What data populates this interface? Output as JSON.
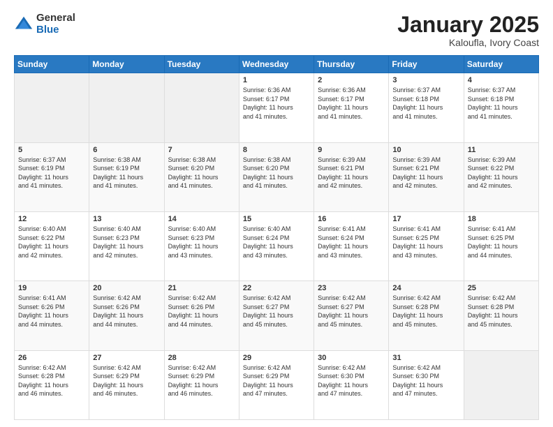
{
  "logo": {
    "general": "General",
    "blue": "Blue"
  },
  "title": {
    "month": "January 2025",
    "location": "Kaloufla, Ivory Coast"
  },
  "weekdays": [
    "Sunday",
    "Monday",
    "Tuesday",
    "Wednesday",
    "Thursday",
    "Friday",
    "Saturday"
  ],
  "weeks": [
    [
      {
        "day": "",
        "info": ""
      },
      {
        "day": "",
        "info": ""
      },
      {
        "day": "",
        "info": ""
      },
      {
        "day": "1",
        "info": "Sunrise: 6:36 AM\nSunset: 6:17 PM\nDaylight: 11 hours\nand 41 minutes."
      },
      {
        "day": "2",
        "info": "Sunrise: 6:36 AM\nSunset: 6:17 PM\nDaylight: 11 hours\nand 41 minutes."
      },
      {
        "day": "3",
        "info": "Sunrise: 6:37 AM\nSunset: 6:18 PM\nDaylight: 11 hours\nand 41 minutes."
      },
      {
        "day": "4",
        "info": "Sunrise: 6:37 AM\nSunset: 6:18 PM\nDaylight: 11 hours\nand 41 minutes."
      }
    ],
    [
      {
        "day": "5",
        "info": "Sunrise: 6:37 AM\nSunset: 6:19 PM\nDaylight: 11 hours\nand 41 minutes."
      },
      {
        "day": "6",
        "info": "Sunrise: 6:38 AM\nSunset: 6:19 PM\nDaylight: 11 hours\nand 41 minutes."
      },
      {
        "day": "7",
        "info": "Sunrise: 6:38 AM\nSunset: 6:20 PM\nDaylight: 11 hours\nand 41 minutes."
      },
      {
        "day": "8",
        "info": "Sunrise: 6:38 AM\nSunset: 6:20 PM\nDaylight: 11 hours\nand 41 minutes."
      },
      {
        "day": "9",
        "info": "Sunrise: 6:39 AM\nSunset: 6:21 PM\nDaylight: 11 hours\nand 42 minutes."
      },
      {
        "day": "10",
        "info": "Sunrise: 6:39 AM\nSunset: 6:21 PM\nDaylight: 11 hours\nand 42 minutes."
      },
      {
        "day": "11",
        "info": "Sunrise: 6:39 AM\nSunset: 6:22 PM\nDaylight: 11 hours\nand 42 minutes."
      }
    ],
    [
      {
        "day": "12",
        "info": "Sunrise: 6:40 AM\nSunset: 6:22 PM\nDaylight: 11 hours\nand 42 minutes."
      },
      {
        "day": "13",
        "info": "Sunrise: 6:40 AM\nSunset: 6:23 PM\nDaylight: 11 hours\nand 42 minutes."
      },
      {
        "day": "14",
        "info": "Sunrise: 6:40 AM\nSunset: 6:23 PM\nDaylight: 11 hours\nand 43 minutes."
      },
      {
        "day": "15",
        "info": "Sunrise: 6:40 AM\nSunset: 6:24 PM\nDaylight: 11 hours\nand 43 minutes."
      },
      {
        "day": "16",
        "info": "Sunrise: 6:41 AM\nSunset: 6:24 PM\nDaylight: 11 hours\nand 43 minutes."
      },
      {
        "day": "17",
        "info": "Sunrise: 6:41 AM\nSunset: 6:25 PM\nDaylight: 11 hours\nand 43 minutes."
      },
      {
        "day": "18",
        "info": "Sunrise: 6:41 AM\nSunset: 6:25 PM\nDaylight: 11 hours\nand 44 minutes."
      }
    ],
    [
      {
        "day": "19",
        "info": "Sunrise: 6:41 AM\nSunset: 6:26 PM\nDaylight: 11 hours\nand 44 minutes."
      },
      {
        "day": "20",
        "info": "Sunrise: 6:42 AM\nSunset: 6:26 PM\nDaylight: 11 hours\nand 44 minutes."
      },
      {
        "day": "21",
        "info": "Sunrise: 6:42 AM\nSunset: 6:26 PM\nDaylight: 11 hours\nand 44 minutes."
      },
      {
        "day": "22",
        "info": "Sunrise: 6:42 AM\nSunset: 6:27 PM\nDaylight: 11 hours\nand 45 minutes."
      },
      {
        "day": "23",
        "info": "Sunrise: 6:42 AM\nSunset: 6:27 PM\nDaylight: 11 hours\nand 45 minutes."
      },
      {
        "day": "24",
        "info": "Sunrise: 6:42 AM\nSunset: 6:28 PM\nDaylight: 11 hours\nand 45 minutes."
      },
      {
        "day": "25",
        "info": "Sunrise: 6:42 AM\nSunset: 6:28 PM\nDaylight: 11 hours\nand 45 minutes."
      }
    ],
    [
      {
        "day": "26",
        "info": "Sunrise: 6:42 AM\nSunset: 6:28 PM\nDaylight: 11 hours\nand 46 minutes."
      },
      {
        "day": "27",
        "info": "Sunrise: 6:42 AM\nSunset: 6:29 PM\nDaylight: 11 hours\nand 46 minutes."
      },
      {
        "day": "28",
        "info": "Sunrise: 6:42 AM\nSunset: 6:29 PM\nDaylight: 11 hours\nand 46 minutes."
      },
      {
        "day": "29",
        "info": "Sunrise: 6:42 AM\nSunset: 6:29 PM\nDaylight: 11 hours\nand 47 minutes."
      },
      {
        "day": "30",
        "info": "Sunrise: 6:42 AM\nSunset: 6:30 PM\nDaylight: 11 hours\nand 47 minutes."
      },
      {
        "day": "31",
        "info": "Sunrise: 6:42 AM\nSunset: 6:30 PM\nDaylight: 11 hours\nand 47 minutes."
      },
      {
        "day": "",
        "info": ""
      }
    ]
  ]
}
